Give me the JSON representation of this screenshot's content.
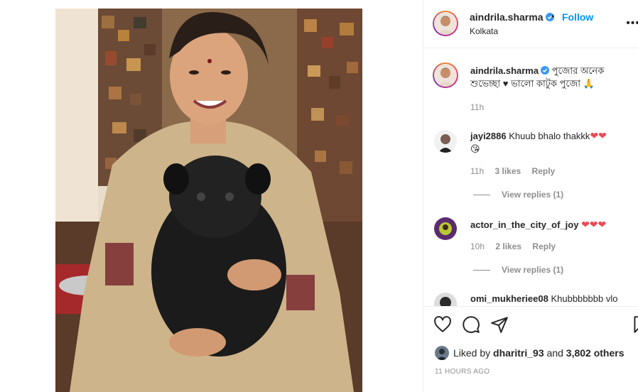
{
  "post": {
    "author": "aindrila.sharma",
    "location": "Kolkata",
    "follow_label": "Follow",
    "dot": "•"
  },
  "caption": {
    "username": "aindrila.sharma",
    "text": "পুজোর অনেক শুভেচ্ছা ♥ ভালো কাটুক পুজো 🙏",
    "time": "11h"
  },
  "comments": [
    {
      "username": "jayi2886",
      "text": "Khuub bhalo thakkk",
      "emoji": "❤❤",
      "emoji2": "😘",
      "time": "11h",
      "likes": "3 likes",
      "reply": "Reply",
      "view_replies": "View replies (1)"
    },
    {
      "username": "actor_in_the_city_of_joy",
      "text": "",
      "emoji": "❤❤❤",
      "time": "10h",
      "likes": "2 likes",
      "reply": "Reply",
      "view_replies": "View replies (1)"
    },
    {
      "username": "omi_mukheriee08",
      "text": "Khubbbbbbb vlo"
    }
  ],
  "likes_summary": {
    "prefix": "Liked by",
    "user": "dharitri_93",
    "middle": "and",
    "others": "3,802 others"
  },
  "timestamp": "11 HOURS AGO",
  "icons": [
    "heart-outline-icon",
    "comment-icon",
    "share-icon",
    "bookmark-icon",
    "verified-badge-icon",
    "more-options-icon"
  ],
  "colors": {
    "accent": "#0095f6",
    "verified": "#3897f0",
    "heart": "#ed4956",
    "muted": "#8e8e8e"
  }
}
